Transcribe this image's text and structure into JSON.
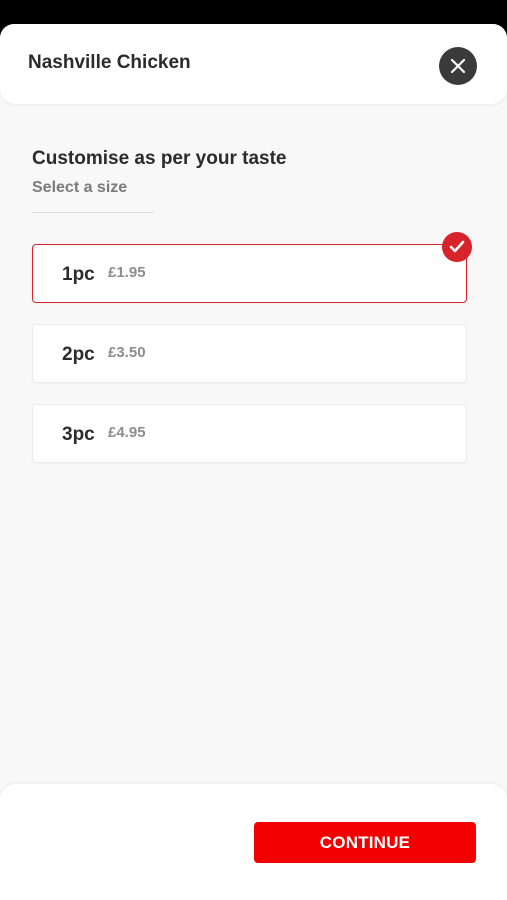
{
  "header": {
    "title": "Nashville Chicken",
    "close_icon": "close-icon"
  },
  "customise": {
    "heading": "Customise as per your taste",
    "subheading": "Select a size"
  },
  "sizes": [
    {
      "label": "1pc",
      "price": "£1.95",
      "selected": true
    },
    {
      "label": "2pc",
      "price": "£3.50",
      "selected": false
    },
    {
      "label": "3pc",
      "price": "£4.95",
      "selected": false
    }
  ],
  "footer": {
    "continue_label": "CONTINUE"
  },
  "colors": {
    "accent": "#d9232a",
    "button": "#f20000",
    "background": "#f8f8f8"
  }
}
